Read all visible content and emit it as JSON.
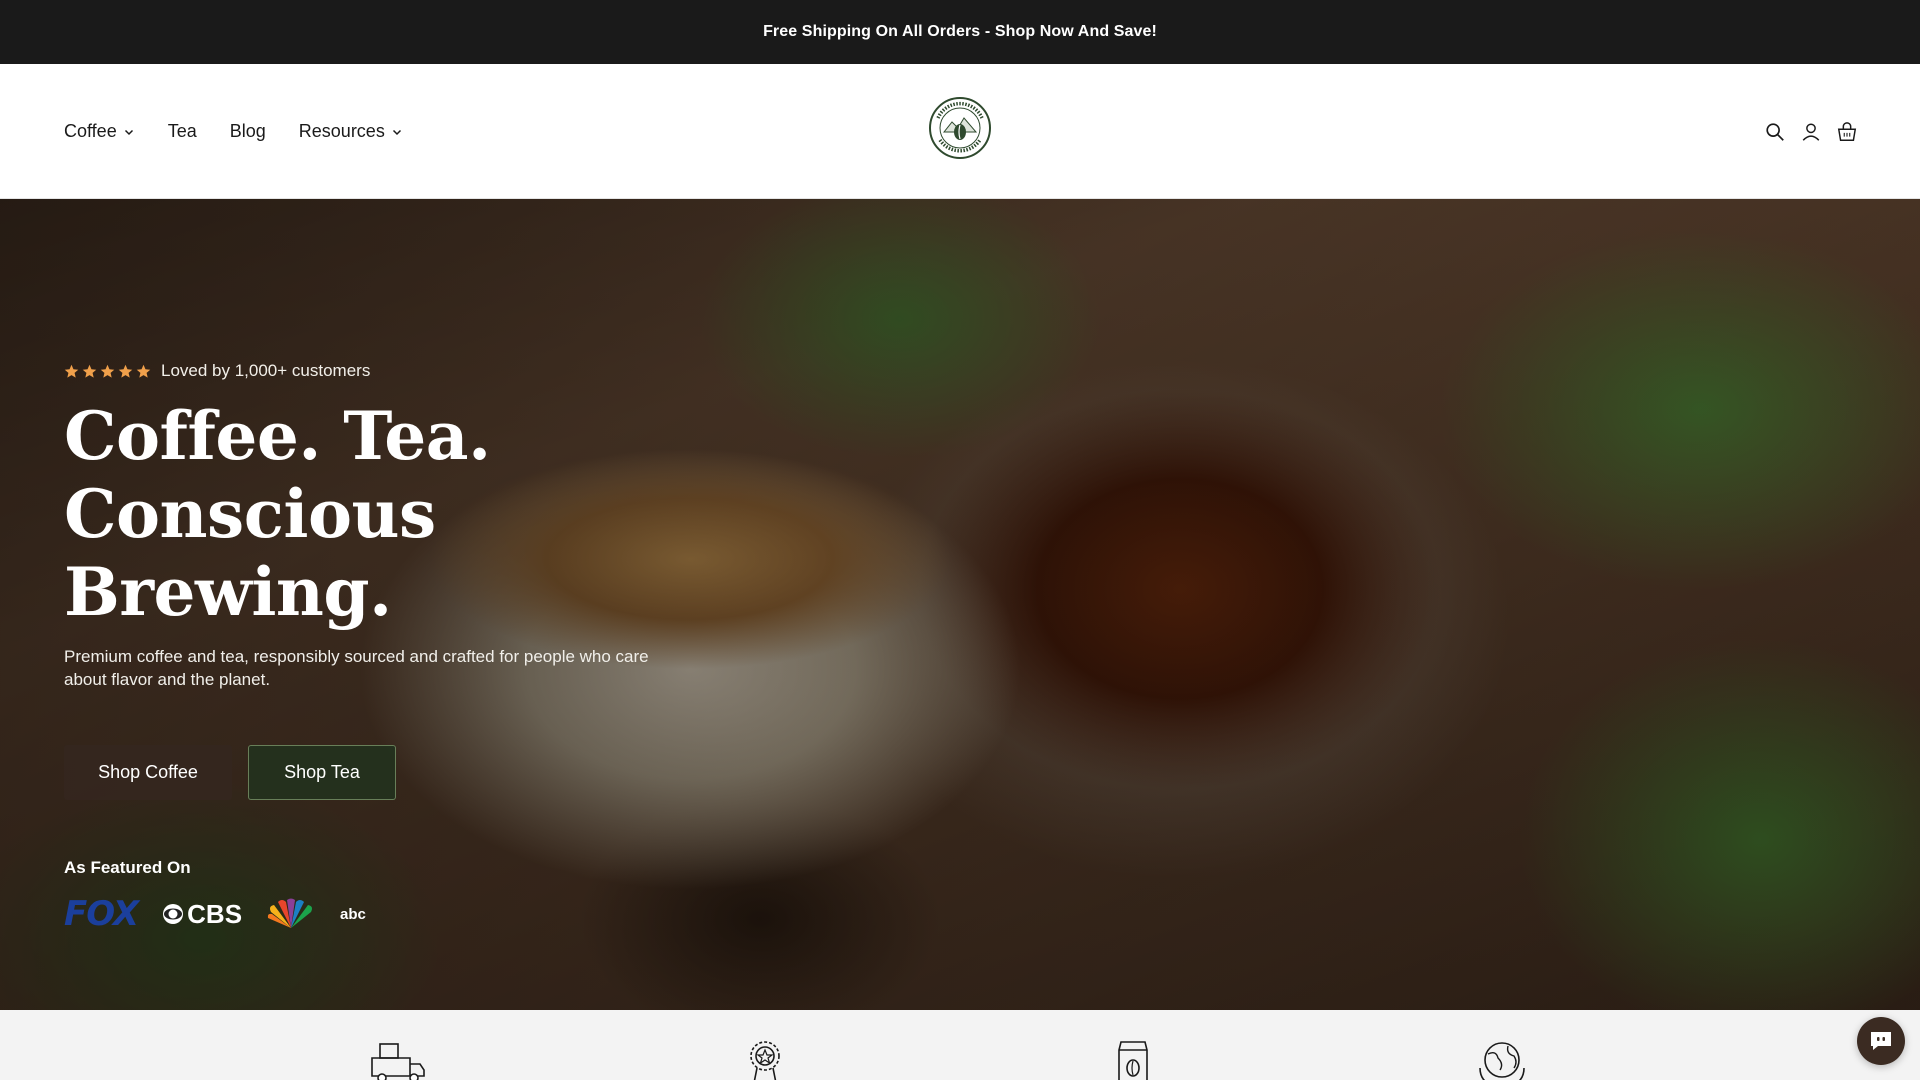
{
  "announcement": {
    "text": "Free Shipping On All Orders - Shop Now And Save!"
  },
  "nav": {
    "items": [
      {
        "label": "Coffee",
        "has_dropdown": true
      },
      {
        "label": "Tea",
        "has_dropdown": false
      },
      {
        "label": "Blog",
        "has_dropdown": false
      },
      {
        "label": "Resources",
        "has_dropdown": true
      }
    ]
  },
  "logo": {
    "top_text": "ECOVIBE ROAST",
    "bottom_text": "SUSTAINABLE COFFEE",
    "icon": "coffee-bean-mountain-logo"
  },
  "header_icons": [
    "search-icon",
    "account-icon",
    "cart-icon"
  ],
  "hero": {
    "rating": {
      "stars": 5,
      "text": "Loved by 1,000+ customers",
      "star_color": "#f0a04b"
    },
    "headline_line1": "Coffee. Tea.",
    "headline_line2": "Conscious Brewing.",
    "subtext": "Premium coffee and tea, responsibly sourced and crafted for people who care about flavor and the planet.",
    "cta_primary": "Shop Coffee",
    "cta_secondary": "Shop Tea",
    "featured_label": "As Featured On",
    "featured_logos": [
      "FOX",
      "CBS",
      "NBC",
      "abc"
    ]
  },
  "features": {
    "icons": [
      "delivery-truck-icon",
      "award-badge-icon",
      "coffee-bag-icon",
      "globe-hands-icon"
    ]
  },
  "chat": {
    "icon": "chat-bubble-icon"
  },
  "colors": {
    "announcement_bg": "#1a1a1a",
    "fox_blue": "#1b3f9c",
    "cta_coffee": "#34261e",
    "cta_tea": "#22321e"
  }
}
